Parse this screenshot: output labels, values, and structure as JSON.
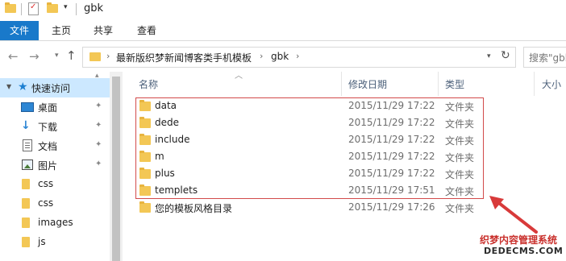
{
  "window": {
    "title": "gbk"
  },
  "ribbon": {
    "tabs": [
      "文件",
      "主页",
      "共享",
      "查看"
    ]
  },
  "address": {
    "crumbs": [
      "最新版织梦新闻博客类手机模板",
      "gbk"
    ],
    "search_placeholder": "搜索\"gbk\""
  },
  "navpane": {
    "items": [
      {
        "label": "快速访问",
        "icon": "star-icon",
        "pinned": false
      },
      {
        "label": "桌面",
        "icon": "desktop-icon",
        "pinned": true
      },
      {
        "label": "下载",
        "icon": "download-icon",
        "pinned": true
      },
      {
        "label": "文档",
        "icon": "document-icon",
        "pinned": true
      },
      {
        "label": "图片",
        "icon": "picture-icon",
        "pinned": true
      },
      {
        "label": "css",
        "icon": "folder-icon",
        "pinned": false
      },
      {
        "label": "css",
        "icon": "folder-icon",
        "pinned": false
      },
      {
        "label": "images",
        "icon": "folder-icon",
        "pinned": false
      },
      {
        "label": "js",
        "icon": "folder-icon",
        "pinned": false
      }
    ]
  },
  "filelist": {
    "columns": {
      "name": "名称",
      "date": "修改日期",
      "type": "类型",
      "size": "大小"
    },
    "rows": [
      {
        "name": "data",
        "date": "2015/11/29 17:22",
        "type": "文件夹"
      },
      {
        "name": "dede",
        "date": "2015/11/29 17:22",
        "type": "文件夹"
      },
      {
        "name": "include",
        "date": "2015/11/29 17:22",
        "type": "文件夹"
      },
      {
        "name": "m",
        "date": "2015/11/29 17:22",
        "type": "文件夹"
      },
      {
        "name": "plus",
        "date": "2015/11/29 17:22",
        "type": "文件夹"
      },
      {
        "name": "templets",
        "date": "2015/11/29 17:51",
        "type": "文件夹"
      },
      {
        "name": "您的模板风格目录",
        "date": "2015/11/29 17:26",
        "type": "文件夹"
      }
    ]
  },
  "annotation": {
    "box_color": "#d24a4a",
    "arrow_color": "#d83a3a"
  },
  "watermark": {
    "line1": "织梦内容管理系统",
    "line2": "DEDECMS.COM"
  },
  "colors": {
    "accent": "#1979ca",
    "selection": "#cce8ff",
    "folder": "#f3c755"
  }
}
